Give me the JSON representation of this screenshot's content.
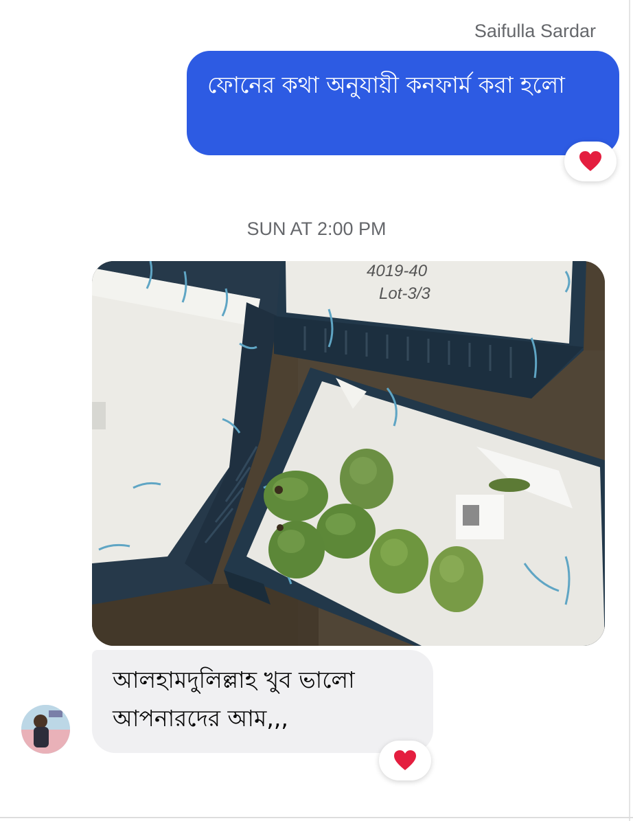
{
  "thread": {
    "outgoing": {
      "sender_name": "Saifulla Sardar",
      "message": "ফোনের কথা অনুযায়ী কনফার্ম করা হলো",
      "reaction": "heart-icon"
    },
    "timestamp": "SUN AT 2:00 PM",
    "incoming": {
      "message": "আলহামদুলিল্লাহ খুব ভালো আপনারদের আম,,,",
      "reaction": "heart-icon"
    },
    "photo_text": {
      "crate_note_line1": "4019-40",
      "crate_note_line2": "Lot-3/3"
    }
  },
  "colors": {
    "outgoing_bubble": "#2d5be3",
    "incoming_bubble": "#f0f0f2",
    "meta_text": "#65676b",
    "heart": "#e41e3f"
  }
}
